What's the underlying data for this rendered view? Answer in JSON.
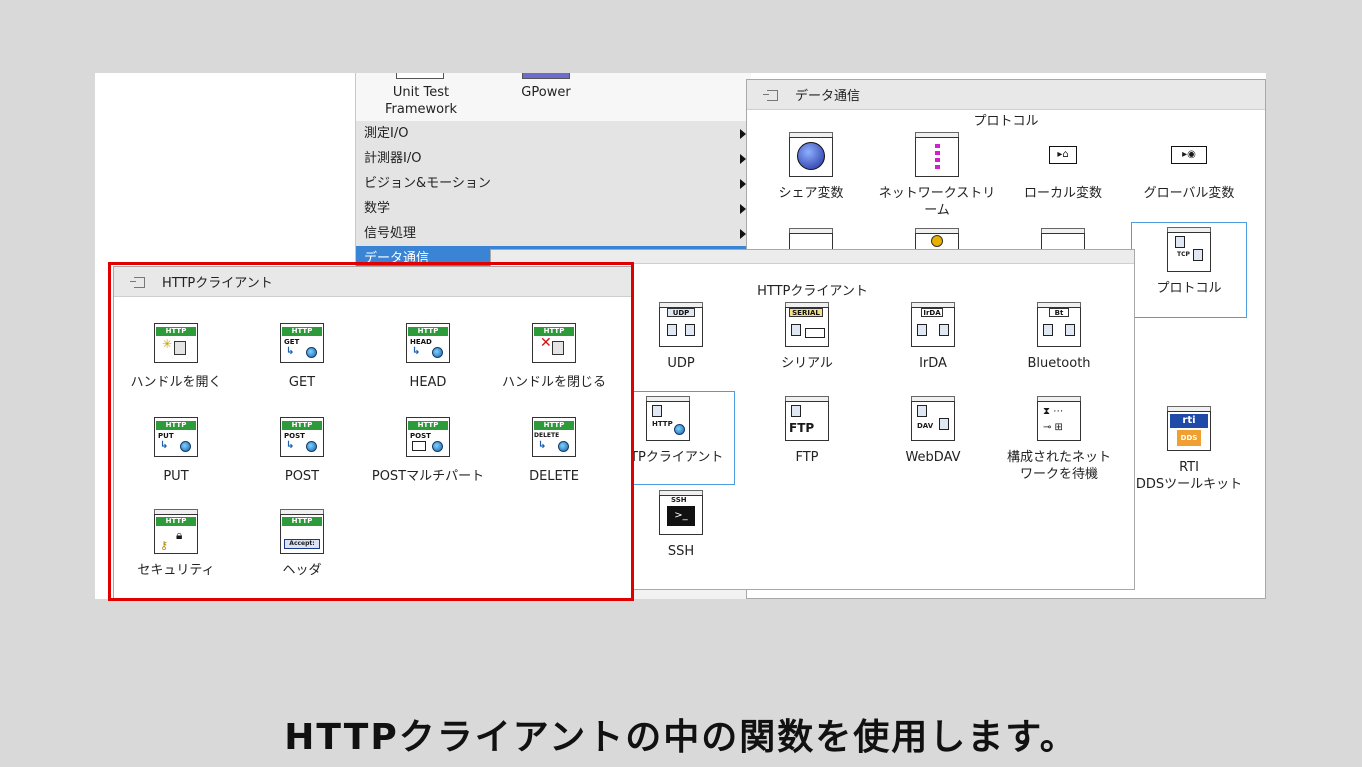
{
  "left_palette": {
    "top_items": [
      "Unit Test\nFramework",
      "GPower"
    ],
    "menu": [
      "測定I/O",
      "計測器I/O",
      "ビジョン&モーション",
      "数学",
      "信号処理",
      "データ通信"
    ],
    "selected_index": 5
  },
  "data_comm": {
    "title": "データ通信",
    "section": "プロトコル",
    "items": [
      "シェア変数",
      "ネットワークストリーム",
      "ローカル変数",
      "グローバル変数",
      "プロトコル"
    ]
  },
  "protocol": {
    "section": "HTTPクライアント",
    "items": [
      "UDP",
      "シリアル",
      "IrDA",
      "Bluetooth",
      "HTTPクライアント",
      "FTP",
      "WebDAV",
      "構成されたネットワークを待機",
      "SSH"
    ],
    "icon_text": {
      "udp": "UDP",
      "serial": "SERIAL",
      "irda": "IrDA",
      "bt": "Bt",
      "http": "HTTP",
      "ftp": "FTP",
      "dav": "DAV",
      "ssh": "SSH"
    }
  },
  "rti": {
    "label": "RTI\nDDSツールキット",
    "logo": "rti",
    "dds": "DDS"
  },
  "http_client": {
    "title": "HTTPクライアント",
    "items": [
      "ハンドルを開く",
      "GET",
      "HEAD",
      "ハンドルを閉じる",
      "PUT",
      "POST",
      "POSTマルチパート",
      "DELETE",
      "セキュリティ",
      "ヘッダ"
    ],
    "icon_header": "HTTP",
    "icon_verbs": [
      "GET",
      "HEAD",
      "PUT",
      "POST",
      "POST",
      "DELETE"
    ],
    "accept_text": "Accept:"
  },
  "caption": "HTTPクライアントの中の関数を使用します。",
  "colors": {
    "highlight": "#e00000",
    "selected_menu": "#3a84d6",
    "http_green": "#2e9b3b"
  }
}
